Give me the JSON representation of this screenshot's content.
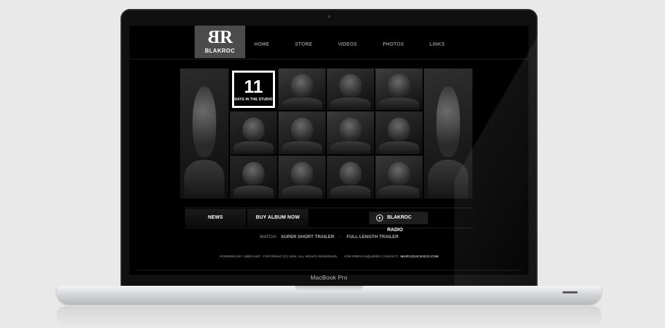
{
  "site": {
    "logo_mark": "BR",
    "logo_word": "BLAKROC",
    "nav": [
      "HOME",
      "STORE",
      "VIDEOS",
      "PHOTOS",
      "LINKS"
    ],
    "promo": {
      "number": "11",
      "label": "DAYS IN THE STUDIO"
    },
    "actions": {
      "news": "NEWS",
      "buy": "BUY ALBUM NOW",
      "radio": "BLAKROC RADIO"
    },
    "watch": {
      "label": "WATCH:",
      "link1": "SUPER SHORT TRAILER",
      "separator": "-",
      "link2": "FULL LENGTH TRAILER"
    },
    "footer": {
      "powered": "POWERED BY: DBRS.NET",
      "copyright": "COPYRIGHT (C) 2009. ALL RIGHTS RESERVED.",
      "press": "FOR PRESS INQUIRIES CONTACT:",
      "email": "MARY@SACKSCO.COM"
    }
  },
  "device": {
    "label": "MacBook Pro"
  },
  "collage_tiles": [
    {
      "name": "photo-tile-guitarist"
    },
    {
      "name": "photo-tile-1"
    },
    {
      "name": "photo-tile-2"
    },
    {
      "name": "photo-tile-3"
    },
    {
      "name": "photo-tile-4"
    },
    {
      "name": "photo-tile-5"
    },
    {
      "name": "photo-tile-6"
    },
    {
      "name": "photo-tile-7"
    },
    {
      "name": "photo-tile-8"
    },
    {
      "name": "photo-tile-9"
    },
    {
      "name": "photo-tile-10"
    },
    {
      "name": "photo-tile-11"
    },
    {
      "name": "photo-tile-12"
    },
    {
      "name": "photo-tile-13"
    },
    {
      "name": "photo-tile-14"
    }
  ]
}
